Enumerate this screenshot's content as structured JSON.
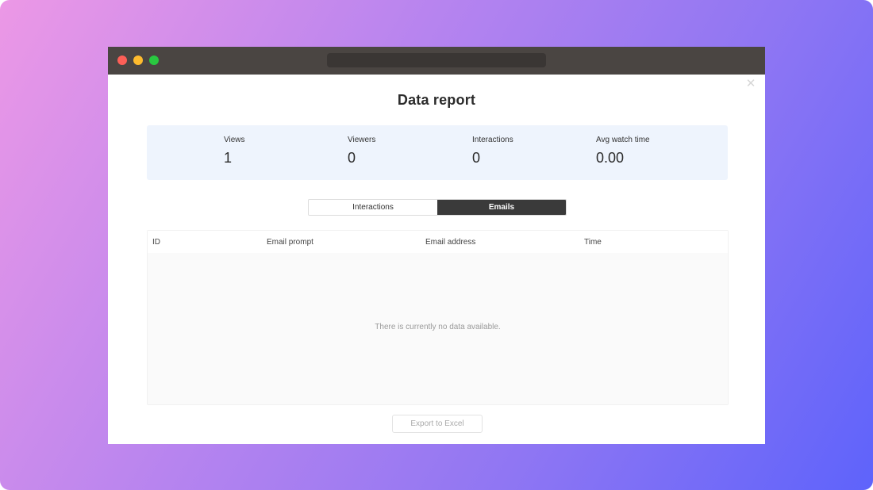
{
  "dialog": {
    "title": "Data report",
    "close_glyph": "✕"
  },
  "stats": [
    {
      "label": "Views",
      "value": "1"
    },
    {
      "label": "Viewers",
      "value": "0"
    },
    {
      "label": "Interactions",
      "value": "0"
    },
    {
      "label": "Avg watch time",
      "value": "0.00"
    }
  ],
  "tabs": [
    {
      "label": "Interactions",
      "active": false
    },
    {
      "label": "Emails",
      "active": true
    }
  ],
  "table": {
    "columns": [
      "ID",
      "Email prompt",
      "Email address",
      "Time"
    ],
    "rows": [],
    "empty_text": "There is currently no data available."
  },
  "export_button": {
    "label": "Export to Excel",
    "disabled": true
  },
  "colors": {
    "active_tab": "#3a3a3a",
    "stats_bg": "#eef4fd",
    "traffic_red": "#fd5f57",
    "traffic_yellow": "#febb2e",
    "traffic_green": "#29c840"
  },
  "icons": {
    "close": "close-icon",
    "window_controls": [
      "close-window-icon",
      "minimize-window-icon",
      "maximize-window-icon"
    ]
  }
}
